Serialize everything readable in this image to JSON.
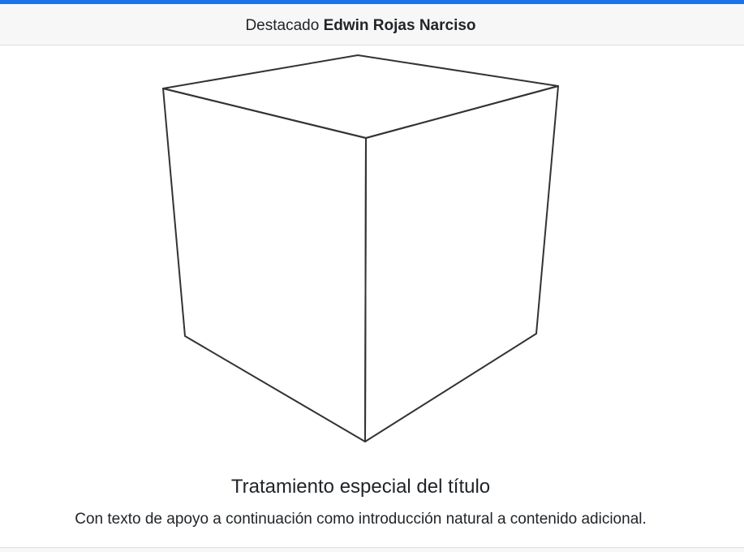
{
  "header": {
    "prefix": "Destacado",
    "highlight": "Edwin Rojas Narciso"
  },
  "image": {
    "icon": "cube-icon"
  },
  "card": {
    "title": "Tratamiento especial del título",
    "text": "Con texto de apoyo a continuación como introducción natural a contenido adicional."
  },
  "colors": {
    "accent": "#1a73e8",
    "header_bg": "#f7f7f7",
    "text": "#212529",
    "stroke": "#333333"
  }
}
